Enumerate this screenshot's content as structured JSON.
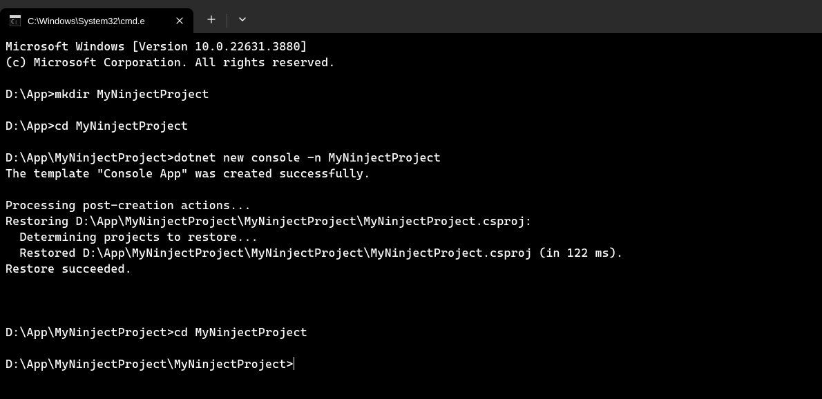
{
  "tab": {
    "title": "C:\\Windows\\System32\\cmd.e",
    "icon": "cmd-icon"
  },
  "terminal": {
    "lines": [
      "Microsoft Windows [Version 10.0.22631.3880]",
      "(c) Microsoft Corporation. All rights reserved.",
      "",
      "D:\\App>mkdir MyNinjectProject",
      "",
      "D:\\App>cd MyNinjectProject",
      "",
      "D:\\App\\MyNinjectProject>dotnet new console -n MyNinjectProject",
      "The template \"Console App\" was created successfully.",
      "",
      "Processing post-creation actions...",
      "Restoring D:\\App\\MyNinjectProject\\MyNinjectProject\\MyNinjectProject.csproj:",
      "  Determining projects to restore...",
      "  Restored D:\\App\\MyNinjectProject\\MyNinjectProject\\MyNinjectProject.csproj (in 122 ms).",
      "Restore succeeded.",
      "",
      "",
      "",
      "D:\\App\\MyNinjectProject>cd MyNinjectProject",
      ""
    ],
    "prompt": "D:\\App\\MyNinjectProject\\MyNinjectProject>"
  }
}
